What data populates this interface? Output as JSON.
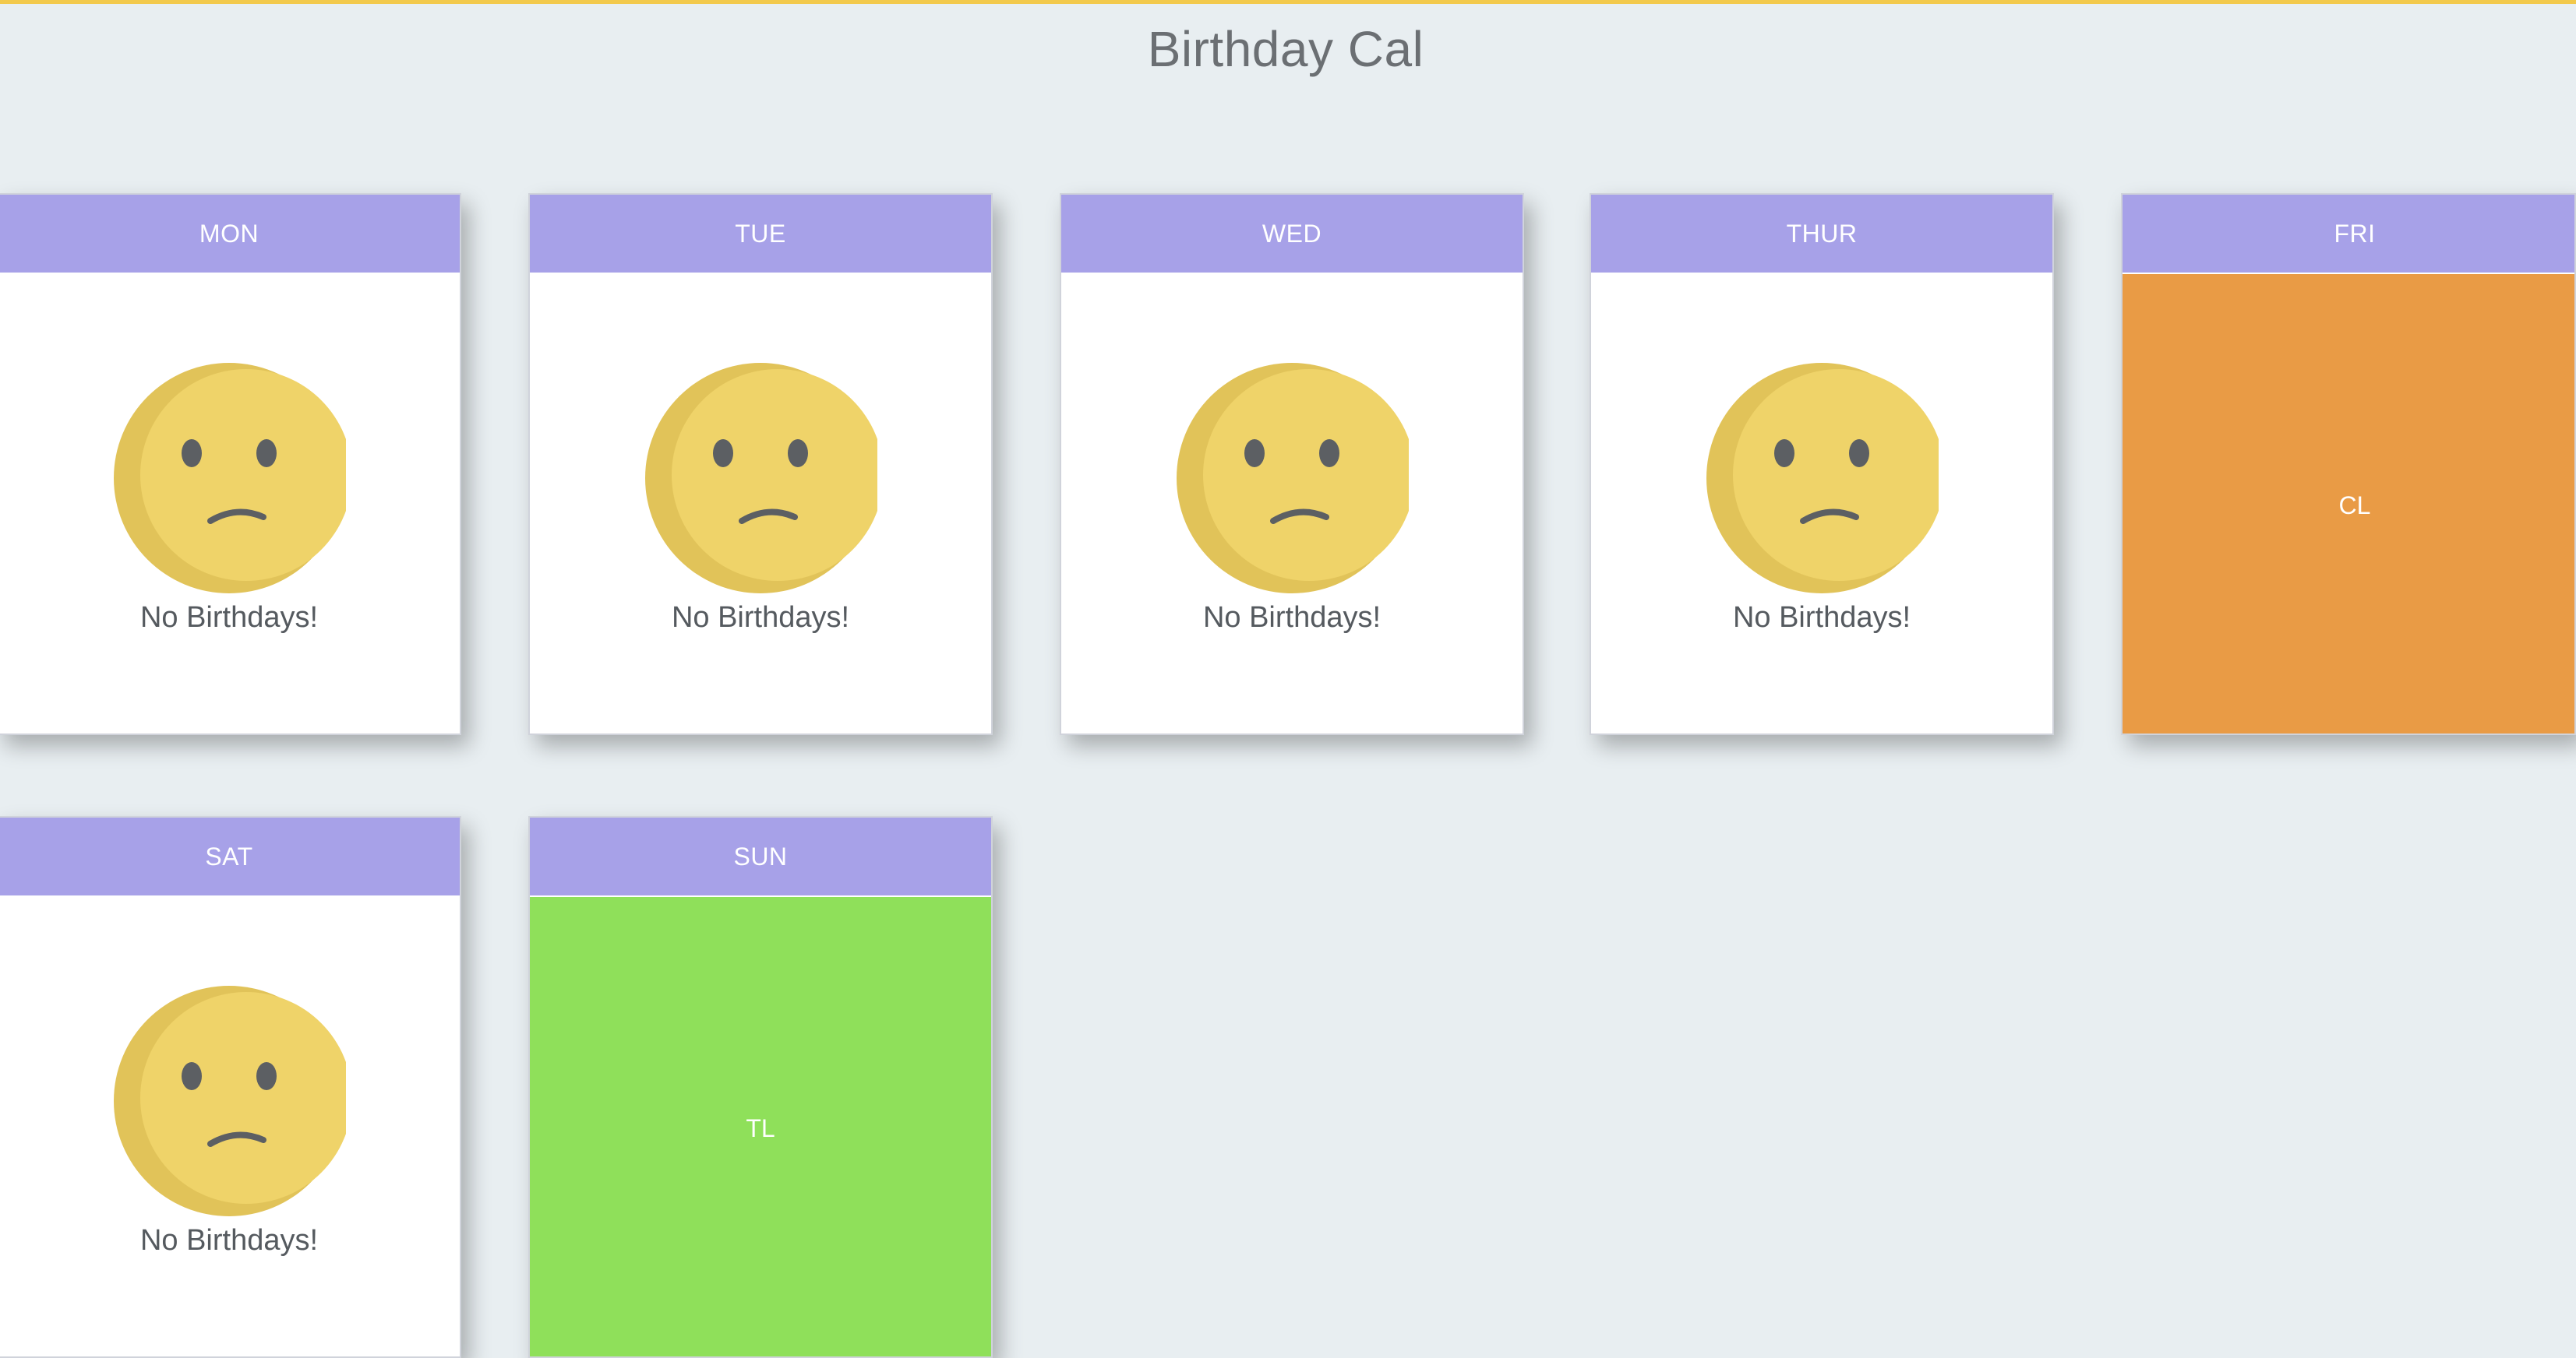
{
  "app": {
    "title": "Birthday Cal"
  },
  "colors": {
    "accent_bar": "#f2c94c",
    "header_bg": "#a7a1e8",
    "page_bg": "#e8eef1",
    "face": "#efd369"
  },
  "days": [
    {
      "label": "MON",
      "status": "empty",
      "message": "No Birthdays!"
    },
    {
      "label": "TUE",
      "status": "empty",
      "message": "No Birthdays!"
    },
    {
      "label": "WED",
      "status": "empty",
      "message": "No Birthdays!"
    },
    {
      "label": "THUR",
      "status": "empty",
      "message": "No Birthdays!"
    },
    {
      "label": "FRI",
      "status": "birthday",
      "initials": "CL",
      "color": "#e99b45"
    },
    {
      "label": "SAT",
      "status": "empty",
      "message": "No Birthdays!"
    },
    {
      "label": "SUN",
      "status": "birthday",
      "initials": "TL",
      "color": "#8fe05a"
    }
  ],
  "icons": {
    "empty_state": "sad-face-icon"
  }
}
